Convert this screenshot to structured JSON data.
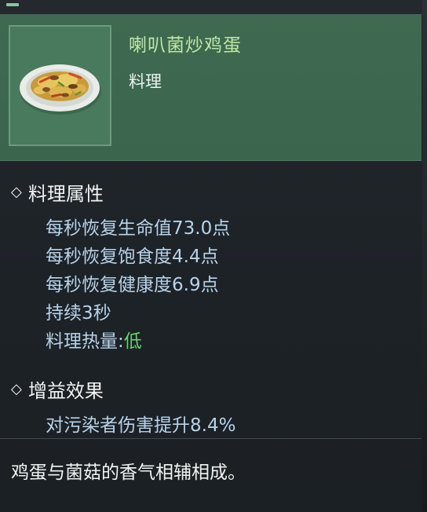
{
  "item": {
    "name": "喇叭菌炒鸡蛋",
    "type": "料理",
    "icon": "mushroom-egg-dish-icon"
  },
  "attributes": {
    "title": "料理属性",
    "lines": [
      "每秒恢复生命值73.0点",
      "每秒恢复饱食度4.4点",
      "每秒恢复健康度6.9点",
      "持续3秒"
    ],
    "heat_label": "料理热量:",
    "heat_value": "低"
  },
  "buff": {
    "title": "增益效果",
    "lines": [
      "对污染者伤害提升8.4%"
    ]
  },
  "flavor_text": "鸡蛋与菌菇的香气相辅相成。",
  "colors": {
    "header_bg": "#3f6a51",
    "name_text": "#bfe7a6",
    "stat_text": "#b7d3ea",
    "heat_low": "#6bd06f"
  }
}
